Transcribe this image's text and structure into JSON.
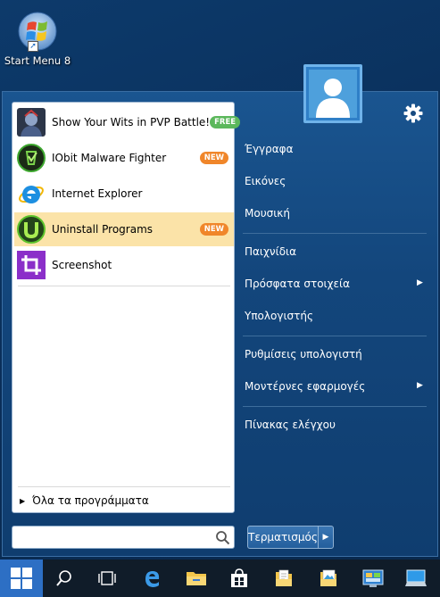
{
  "desktop": {
    "icons": [
      {
        "label": "Start Menu 8",
        "icon": "windows-logo-icon"
      }
    ]
  },
  "start_menu": {
    "pinned_programs": [
      {
        "name": "Show Your Wits in PVP Battle!",
        "badge": "FREE",
        "badge_color": "#5cb85c",
        "icon": "game-avatar-icon"
      },
      {
        "name": "IObit Malware Fighter",
        "badge": "NEW",
        "badge_color": "#f0862a",
        "icon": "iobit-malware-fighter-icon"
      },
      {
        "name": "Internet Explorer",
        "badge": "",
        "icon": "internet-explorer-icon"
      },
      {
        "name": "Uninstall Programs",
        "badge": "NEW",
        "badge_color": "#f0862a",
        "icon": "iobit-uninstaller-icon",
        "highlighted": true
      },
      {
        "name": "Screenshot",
        "badge": "",
        "icon": "crop-icon"
      }
    ],
    "all_programs_label": "Όλα τα προγράμματα",
    "search": {
      "placeholder": "",
      "value": ""
    },
    "right_panel": [
      {
        "label": "Έγγραφα",
        "submenu": false
      },
      {
        "label": "Εικόνες",
        "submenu": false
      },
      {
        "label": "Μουσική",
        "submenu": false
      },
      {
        "label": "Παιχνίδια",
        "submenu": false
      },
      {
        "label": "Πρόσφατα στοιχεία",
        "submenu": true
      },
      {
        "label": "Υπολογιστής",
        "submenu": false
      },
      {
        "label": "Ρυθμίσεις υπολογιστή",
        "submenu": false
      },
      {
        "label": "Μοντέρνες εφαρμογές",
        "submenu": true
      },
      {
        "label": "Πίνακας ελέγχου",
        "submenu": false
      }
    ],
    "shutdown_label": "Τερματισμός",
    "settings_icon": "gear-icon",
    "user_picture_icon": "user-avatar-icon"
  },
  "taskbar": {
    "items": [
      "start-button",
      "search-icon",
      "task-view-icon",
      "edge-icon",
      "file-explorer-icon",
      "store-icon",
      "documents-icon",
      "pictures-icon",
      "control-panel-icon",
      "this-pc-icon"
    ]
  },
  "colors": {
    "accent": "#2d6fc4",
    "highlight": "#fbe3a8",
    "panel_bg": "#13467c"
  }
}
